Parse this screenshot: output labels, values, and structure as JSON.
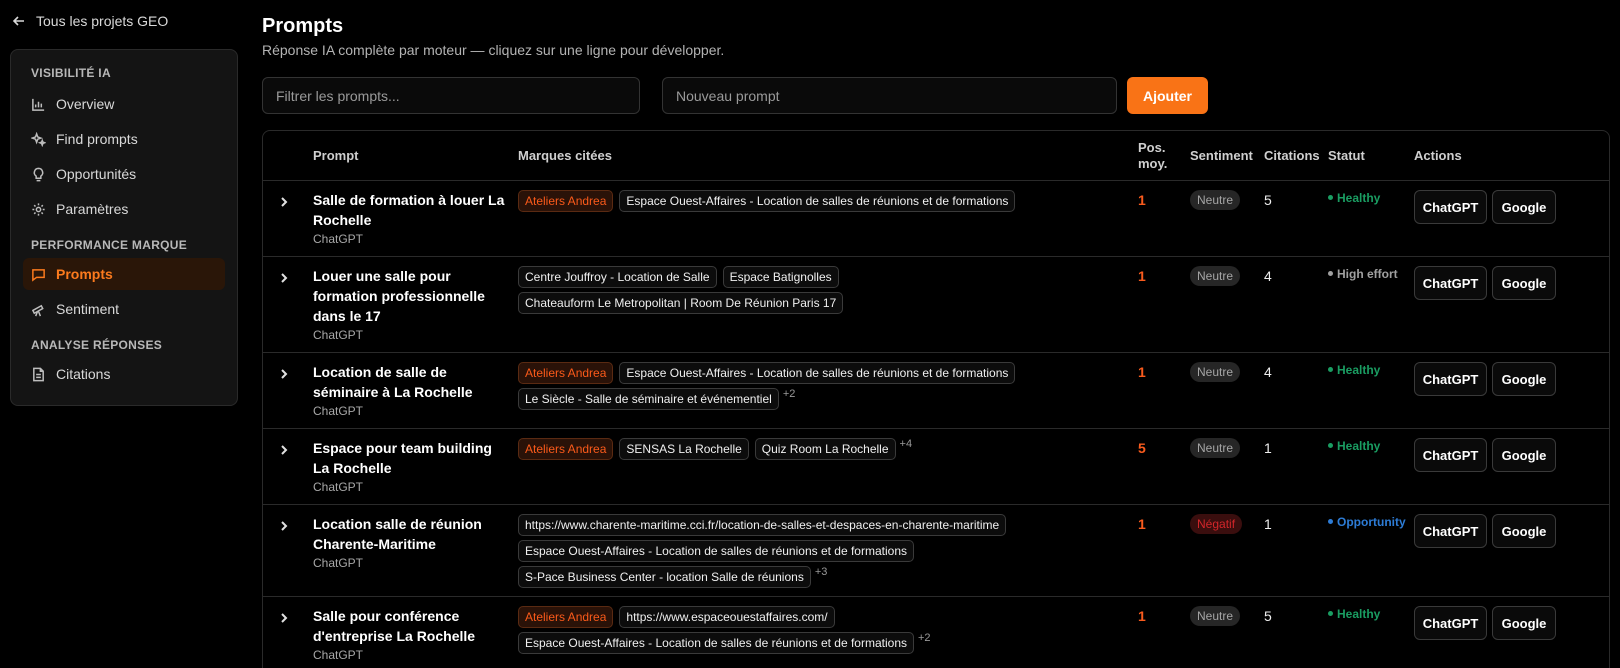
{
  "sidebar": {
    "back_label": "Tous les projets GEO",
    "sections": [
      {
        "title": "VISIBILITÉ IA",
        "items": [
          {
            "label": "Overview",
            "icon": "bar-chart-icon",
            "active": false
          },
          {
            "label": "Find prompts",
            "icon": "sparkles-icon",
            "active": false
          },
          {
            "label": "Opportunités",
            "icon": "lightbulb-icon",
            "active": false
          },
          {
            "label": "Paramètres",
            "icon": "gear-icon",
            "active": false
          }
        ]
      },
      {
        "title": "PERFORMANCE MARQUE",
        "items": [
          {
            "label": "Prompts",
            "icon": "message-square-icon",
            "active": true
          },
          {
            "label": "Sentiment",
            "icon": "telescope-icon",
            "active": false
          }
        ]
      },
      {
        "title": "ANALYSE RÉPONSES",
        "items": [
          {
            "label": "Citations",
            "icon": "file-text-icon",
            "active": false
          }
        ]
      }
    ]
  },
  "header": {
    "title": "Prompts",
    "subtitle": "Réponse IA complète par moteur — cliquez sur une ligne pour développer."
  },
  "toolbar": {
    "filter_placeholder": "Filtrer les prompts...",
    "new_placeholder": "Nouveau prompt",
    "add_label": "Ajouter"
  },
  "table": {
    "columns": {
      "prompt": "Prompt",
      "brands": "Marques citées",
      "pos": "Pos. moy.",
      "sentiment": "Sentiment",
      "citations": "Citations",
      "status": "Statut",
      "actions": "Actions"
    },
    "action_labels": {
      "chatgpt": "ChatGPT",
      "google": "Google"
    },
    "rows": [
      {
        "prompt": "Salle de formation à louer La Rochelle",
        "engine": "ChatGPT",
        "brands": [
          {
            "name": "Ateliers Andrea",
            "own": true
          },
          {
            "name": "Espace Ouest-Affaires - Location de salles de réunions et de formations",
            "own": false
          }
        ],
        "more": "",
        "pos": "1",
        "sentiment": "Neutre",
        "citations": "5",
        "status": "Healthy",
        "status_type": "healthy"
      },
      {
        "prompt": "Louer une salle pour formation professionnelle dans le 17",
        "engine": "ChatGPT",
        "brands": [
          {
            "name": "Centre Jouffroy - Location de Salle",
            "own": false
          },
          {
            "name": "Espace Batignolles",
            "own": false
          },
          {
            "name": "Chateauform Le Metropolitan | Room De Réunion Paris 17",
            "own": false
          }
        ],
        "more": "",
        "pos": "1",
        "sentiment": "Neutre",
        "citations": "4",
        "status": "High effort",
        "status_type": "effort"
      },
      {
        "prompt": "Location de salle de séminaire à La Rochelle",
        "engine": "ChatGPT",
        "brands": [
          {
            "name": "Ateliers Andrea",
            "own": true
          },
          {
            "name": "Espace Ouest-Affaires - Location de salles de réunions et de formations",
            "own": false
          },
          {
            "name": "Le Siècle - Salle de séminaire et événementiel",
            "own": false
          }
        ],
        "more": "+2",
        "pos": "1",
        "sentiment": "Neutre",
        "citations": "4",
        "status": "Healthy",
        "status_type": "healthy"
      },
      {
        "prompt": "Espace pour team building La Rochelle",
        "engine": "ChatGPT",
        "brands": [
          {
            "name": "Ateliers Andrea",
            "own": true
          },
          {
            "name": "SENSAS La Rochelle",
            "own": false
          },
          {
            "name": "Quiz Room La Rochelle",
            "own": false
          }
        ],
        "more": "+4",
        "pos": "5",
        "sentiment": "Neutre",
        "citations": "1",
        "status": "Healthy",
        "status_type": "healthy"
      },
      {
        "prompt": "Location salle de réunion Charente-Maritime",
        "engine": "ChatGPT",
        "brands": [
          {
            "name": "https://www.charente-maritime.cci.fr/location-de-salles-et-despaces-en-charente-maritime",
            "own": false
          },
          {
            "name": "Espace Ouest-Affaires - Location de salles de réunions et de formations",
            "own": false
          },
          {
            "name": "S-Pace Business Center - location Salle de réunions",
            "own": false
          }
        ],
        "more": "+3",
        "pos": "1",
        "sentiment": "Négatif",
        "citations": "1",
        "status": "Opportunity",
        "status_type": "opp"
      },
      {
        "prompt": "Salle pour conférence d'entreprise La Rochelle",
        "engine": "ChatGPT",
        "brands": [
          {
            "name": "Ateliers Andrea",
            "own": true
          },
          {
            "name": "https://www.espaceouestaffaires.com/",
            "own": false
          },
          {
            "name": "Espace Ouest-Affaires - Location de salles de réunions et de formations",
            "own": false
          }
        ],
        "more": "+2",
        "pos": "1",
        "sentiment": "Neutre",
        "citations": "5",
        "status": "Healthy",
        "status_type": "healthy"
      }
    ]
  },
  "colors": {
    "accent": "#f97316",
    "healthy": "#1a9d62",
    "opportunity": "#2d7cd6",
    "negative": "#d2262a"
  }
}
